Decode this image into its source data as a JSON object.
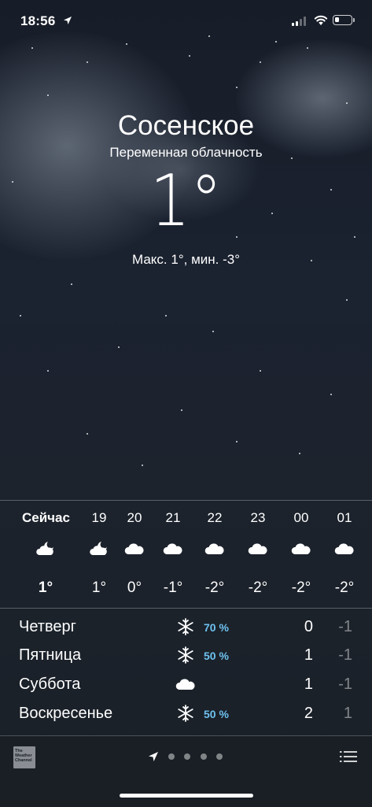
{
  "status_bar": {
    "time": "18:56",
    "battery_level": 0.3
  },
  "location": {
    "city": "Сосенское",
    "condition": "Переменная облачность",
    "temperature": "1°",
    "high_low": "Макс. 1°, мин. -3°"
  },
  "hourly": [
    {
      "time": "Сейчас",
      "icon": "partly-cloudy-night-icon",
      "temp": "1°",
      "bold": true
    },
    {
      "time": "19",
      "icon": "partly-cloudy-night-icon",
      "temp": "1°",
      "bold": false
    },
    {
      "time": "20",
      "icon": "cloud-icon",
      "temp": "0°",
      "bold": false
    },
    {
      "time": "21",
      "icon": "cloud-icon",
      "temp": "-1°",
      "bold": false
    },
    {
      "time": "22",
      "icon": "cloud-icon",
      "temp": "-2°",
      "bold": false
    },
    {
      "time": "23",
      "icon": "cloud-icon",
      "temp": "-2°",
      "bold": false
    },
    {
      "time": "00",
      "icon": "cloud-icon",
      "temp": "-2°",
      "bold": false
    },
    {
      "time": "01",
      "icon": "cloud-icon",
      "temp": "-2°",
      "bold": false
    }
  ],
  "daily": [
    {
      "day": "Четверг",
      "icon": "snowflake-icon",
      "precip": "70 %",
      "high": "0",
      "low": "-1"
    },
    {
      "day": "Пятница",
      "icon": "snowflake-icon",
      "precip": "50 %",
      "high": "1",
      "low": "-1"
    },
    {
      "day": "Суббота",
      "icon": "cloud-icon",
      "precip": "",
      "high": "1",
      "low": "-1"
    },
    {
      "day": "Воскресенье",
      "icon": "snowflake-icon",
      "precip": "50 %",
      "high": "2",
      "low": "1"
    }
  ],
  "toolbar": {
    "logo_text": "The Weather Channel",
    "page_count": 4,
    "current_page": "location"
  },
  "colors": {
    "precip": "#6ec1f0",
    "background": "#1b2230",
    "toolbar": "#1a1f26"
  }
}
